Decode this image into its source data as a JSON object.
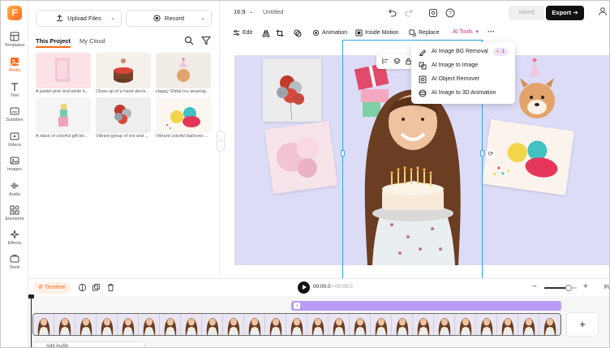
{
  "rail": {
    "items": [
      {
        "label": "Templates",
        "icon": "templates-icon"
      },
      {
        "label": "Media",
        "icon": "media-icon",
        "active": true
      },
      {
        "label": "Text",
        "icon": "text-icon"
      },
      {
        "label": "Subtitles",
        "icon": "subtitles-icon"
      },
      {
        "label": "Videos",
        "icon": "videos-icon"
      },
      {
        "label": "Images",
        "icon": "images-icon"
      },
      {
        "label": "Audio",
        "icon": "audio-icon"
      },
      {
        "label": "Elements",
        "icon": "elements-icon"
      },
      {
        "label": "Effects",
        "icon": "effects-icon"
      },
      {
        "label": "Tools",
        "icon": "tools-icon"
      }
    ]
  },
  "panel": {
    "upload_label": "Upload Files",
    "record_label": "Record",
    "tabs": [
      "This Project",
      "My Cloud"
    ],
    "thumbs": [
      {
        "caption": "A pastel pink and white b..."
      },
      {
        "caption": "Close-up of a hand decor..."
      },
      {
        "caption": "Happy Shiba Inu wearing..."
      },
      {
        "caption": "A stack of colorful gift bo..."
      },
      {
        "caption": "Vibrant group of red and ..."
      },
      {
        "caption": "Vibrant colorful balloons ..."
      }
    ]
  },
  "topbar": {
    "aspect": "16:9",
    "title": "Untitled",
    "saved_label": "Saved",
    "export_label": "Export"
  },
  "toolbar": {
    "edit": "Edit",
    "animation": "Animation",
    "inside_motion": "Inside Motion",
    "replace": "Replace",
    "ai_tools": "AI Tools"
  },
  "ai_menu": {
    "items": [
      {
        "label": "AI Image BG Removal",
        "badge": "-1",
        "icon": "bg-removal-icon"
      },
      {
        "label": "AI Image to Image",
        "icon": "image-to-image-icon"
      },
      {
        "label": "AI Object Remover",
        "icon": "object-remover-icon"
      },
      {
        "label": "AI Image to 3D Animation",
        "icon": "3d-animation-icon"
      }
    ]
  },
  "timeline": {
    "label": "Timeline",
    "current_time": "00:00.0",
    "total_time": "/ 00:05.0",
    "fit_label": "Fi",
    "zoom_level": 0.75,
    "add_audio_label": "Add Audio",
    "add_track_label": "+"
  },
  "colors": {
    "accent": "#ff6a1a",
    "canvas_bg": "#dcdcf7",
    "selection": "#29a8f0",
    "audio_track": "#b99cf3"
  }
}
